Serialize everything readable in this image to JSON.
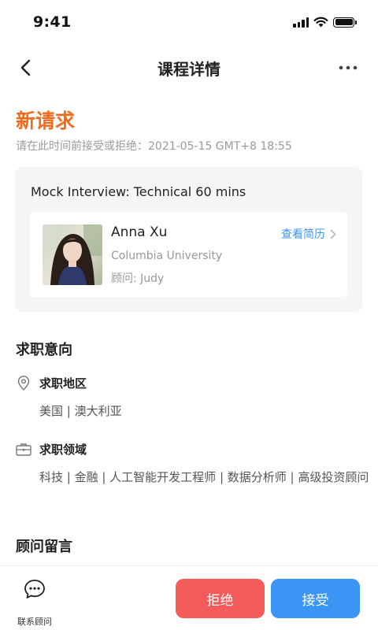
{
  "status_bar": {
    "time": "9:41"
  },
  "nav": {
    "title": "课程详情"
  },
  "request": {
    "title": "新请求",
    "deadline": "请在此时间前接受或拒绝：2021-05-15 GMT+8 18:55"
  },
  "course": {
    "title": "Mock Interview: Technical 60 mins",
    "student": {
      "name": "Anna Xu",
      "school": "Columbia University",
      "advisor": "顾问: Judy",
      "resume_link": "查看简历"
    }
  },
  "job_intent": {
    "title": "求职意向",
    "region_label": "求职地区",
    "region_value": "美国 | 澳大利亚",
    "domain_label": "求职领域",
    "domain_value": "科技 | 金融 | 人工智能开发工程师 | 数据分析师 | 高级投资顾问"
  },
  "advisor_message": {
    "title": "顾问留言"
  },
  "bottom": {
    "contact_label": "联系顾问",
    "reject_label": "拒绝",
    "accept_label": "接受"
  },
  "colors": {
    "accent_orange": "#f26b1d",
    "link_blue": "#3a95f5",
    "reject_red": "#f45b5b",
    "card_bg": "#f4f5f7"
  }
}
